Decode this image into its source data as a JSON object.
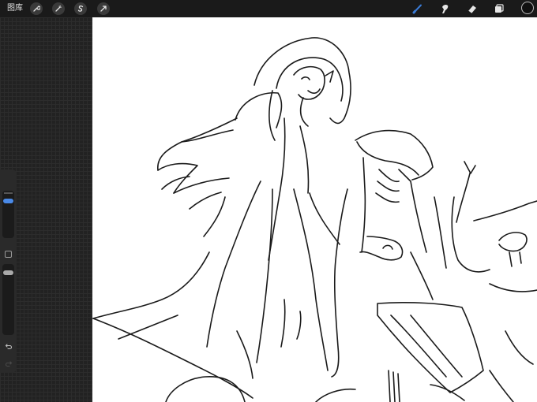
{
  "topbar": {
    "gallery_label": "图库",
    "left_tools": [
      "actions-wrench-icon",
      "adjustments-wand-icon",
      "selection-s-icon",
      "transform-arrow-icon"
    ],
    "right_tools": [
      "brush-icon",
      "smudge-icon",
      "eraser-icon",
      "layers-icon"
    ],
    "active_tool": "brush-icon",
    "accent_color": "#3a7bd5",
    "current_color": "#101010"
  },
  "sidebar": {
    "brush_size_level": 0.28,
    "opacity_level": 0.2,
    "buttons": [
      "modify-square-icon",
      "undo-icon",
      "redo-icon"
    ]
  },
  "canvas": {
    "background": "#ffffff",
    "content": "line sketch"
  }
}
